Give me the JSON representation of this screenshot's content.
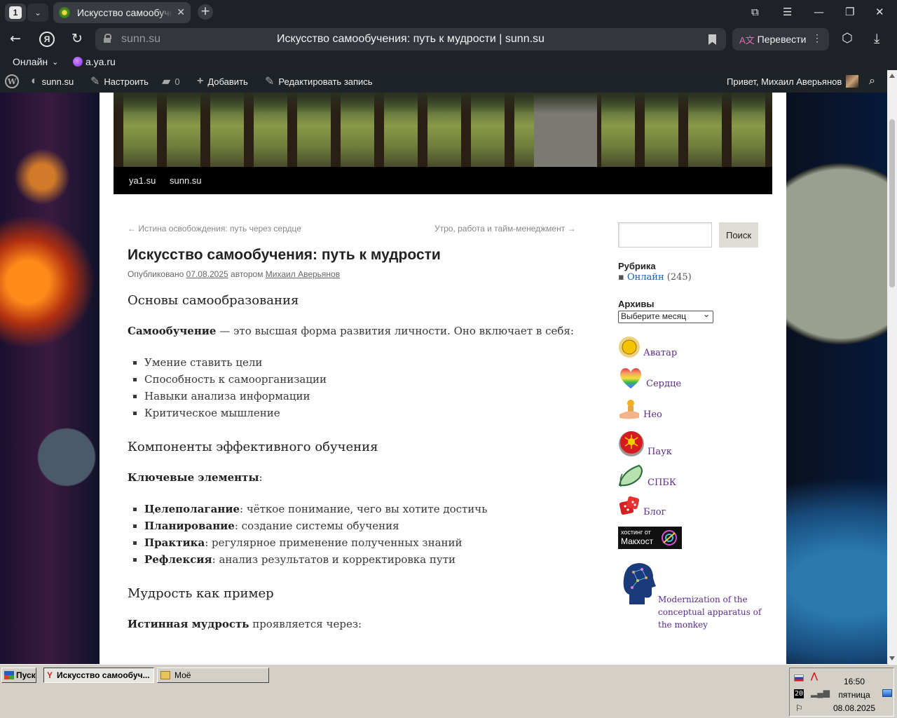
{
  "browser": {
    "tab_count": "1",
    "tab_title": "Искусство самообучения: путь к мудрости | sunn.su",
    "address_host": "sunn.su",
    "address_title": "Искусство самообучения: путь к мудрости | sunn.su",
    "translate_label": "Перевести",
    "bookmarks": [
      {
        "label": "Онлайн"
      },
      {
        "label": "a.ya.ru"
      }
    ]
  },
  "adminbar": {
    "site": "sunn.su",
    "customize": "Настроить",
    "comments_count": "0",
    "add_new": "Добавить",
    "edit_post": "Редактировать запись",
    "greeting": "Привет, Михаил Аверьянов"
  },
  "site_menu": [
    "ya1.su",
    "sunn.su"
  ],
  "post_nav": {
    "prev": "← Истина освобождения: путь через сердце",
    "next": "Утро, работа и тайм-менеджмент →"
  },
  "post": {
    "title": "Искусство самообучения: путь к мудрости",
    "meta_published": "Опубликовано",
    "meta_date": "07.08.2025",
    "meta_by": "автором",
    "meta_author": "Михаил Аверьянов",
    "section1_title": "Основы самообразования",
    "section1_lead_bold": "Самообучение",
    "section1_lead_rest": " — это высшая форма развития личности. Оно включает в себя:",
    "section1_items": [
      "Умение ставить цели",
      "Способность к самоорганизации",
      "Навыки анализа информации",
      "Критическое мышление"
    ],
    "section2_title": "Компоненты эффективного обучения",
    "section2_lead_bold": "Ключевые элементы",
    "section2_lead_rest": ":",
    "section2_items": [
      {
        "bold": "Целеполагание",
        "rest": ": чёткое понимание, чего вы хотите достичь"
      },
      {
        "bold": "Планирование",
        "rest": ": создание системы обучения"
      },
      {
        "bold": "Практика",
        "rest": ": регулярное применение полученных знаний"
      },
      {
        "bold": "Рефлексия",
        "rest": ": анализ результатов и корректировка пути"
      }
    ],
    "section3_title": "Мудрость как пример",
    "section3_lead_bold": "Истинная мудрость",
    "section3_lead_rest": " проявляется через:"
  },
  "sidebar": {
    "search_button": "Поиск",
    "search_value": "",
    "categories_title": "Рубрика",
    "category_name": "Онлайн",
    "category_count": "(245)",
    "archives_title": "Архивы",
    "archives_select": "Выберите месяц",
    "links": [
      "Аватар",
      "Сердце",
      "Нео",
      "Паук",
      "СПБК",
      "Блог"
    ],
    "hosting_line1": "хостинг от",
    "hosting_line2": "Макхост",
    "monkey_link": "Modernization of the conceptual apparatus of the monkey"
  },
  "taskbar": {
    "start": "Пуск",
    "task1": "Искусство самообуч...",
    "task2": "Моё",
    "time": "16:50",
    "day": "пятница",
    "date": "08.08.2025",
    "tray_num": "20"
  }
}
